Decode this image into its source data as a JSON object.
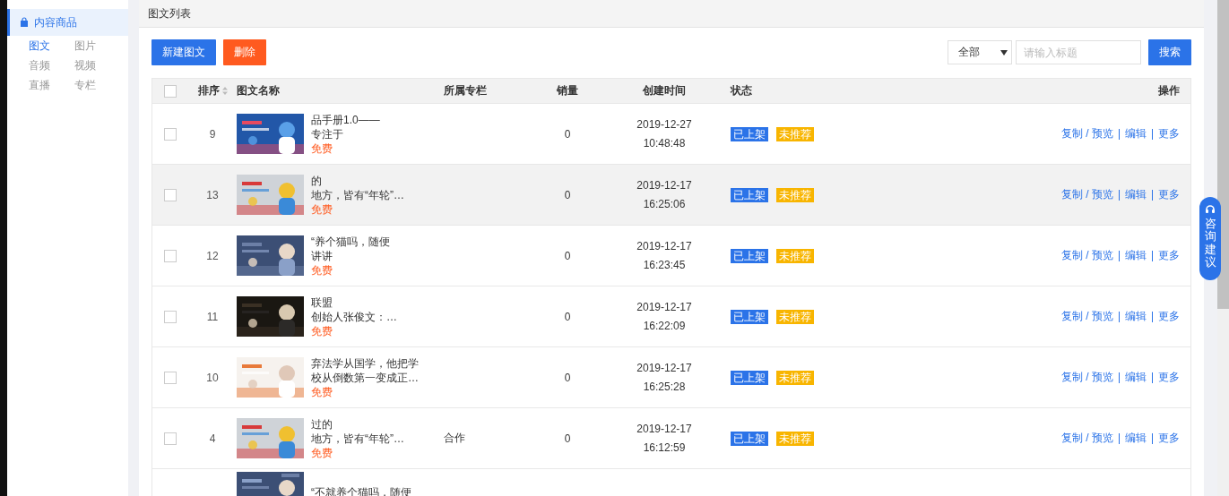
{
  "sidebar": {
    "group": {
      "label": "内容商品",
      "selected": true
    },
    "items": [
      {
        "label": "图文",
        "selected": true
      },
      {
        "label": "图片",
        "selected": false
      },
      {
        "label": "音频",
        "selected": false
      },
      {
        "label": "视频",
        "selected": false
      },
      {
        "label": "直播",
        "selected": false
      },
      {
        "label": "专栏",
        "selected": false
      }
    ]
  },
  "page_title": "图文列表",
  "toolbar": {
    "new_button": "新建图文",
    "delete_button": "删除",
    "filter": {
      "value": "全部"
    },
    "search": {
      "placeholder": "请输入标题"
    },
    "search_button": "搜索"
  },
  "table": {
    "columns": [
      "排序",
      "图文名称",
      "所属专栏",
      "销量",
      "创建时间",
      "状态",
      "操作"
    ],
    "rows": [
      {
        "order": "9",
        "title": [
          "品手册1.0——",
          "专注于"
        ],
        "price": "免费",
        "column": [],
        "sales": "0",
        "date": "2019-12-27",
        "time": "10:48:48",
        "status": "已上架",
        "recommend": "未推荐",
        "hovered": false,
        "actions": [
          "复制 / 预览",
          "编辑",
          "更多"
        ]
      },
      {
        "order": "13",
        "title": [
          "的",
          "地方，皆有“年轮”…"
        ],
        "price": "免费",
        "column": [],
        "sales": "0",
        "date": "2019-12-17",
        "time": "16:25:06",
        "status": "已上架",
        "recommend": "未推荐",
        "hovered": true,
        "actions": [
          "复制 / 预览",
          "编辑",
          "更多"
        ]
      },
      {
        "order": "12",
        "title": [
          "“养个猫吗，随便",
          "讲讲"
        ],
        "price": "免费",
        "column": [],
        "sales": "0",
        "date": "2019-12-17",
        "time": "16:23:45",
        "status": "已上架",
        "recommend": "未推荐",
        "hovered": false,
        "actions": [
          "复制 / 预览",
          "编辑",
          "更多"
        ]
      },
      {
        "order": "11",
        "title": [
          "联盟",
          "创始人张俊文：…"
        ],
        "price": "免费",
        "column": [],
        "sales": "0",
        "date": "2019-12-17",
        "time": "16:22:09",
        "status": "已上架",
        "recommend": "未推荐",
        "hovered": false,
        "actions": [
          "复制 / 预览",
          "编辑",
          "更多"
        ]
      },
      {
        "order": "10",
        "title": [
          "弃法学从国学，他把学",
          "校从倒数第一变成正…"
        ],
        "price": "免费",
        "column": [],
        "sales": "0",
        "date": "2019-12-17",
        "time": "16:25:28",
        "status": "已上架",
        "recommend": "未推荐",
        "hovered": false,
        "actions": [
          "复制 / 预览",
          "编辑",
          "更多"
        ]
      },
      {
        "order": "4",
        "title": [
          "过的",
          "地方，皆有“年轮”…"
        ],
        "price": "免费",
        "column": [
          "合作"
        ],
        "sales": "0",
        "date": "2019-12-17",
        "time": "16:12:59",
        "status": "已上架",
        "recommend": "未推荐",
        "hovered": false,
        "actions": [
          "复制 / 预览",
          "编辑",
          "更多"
        ]
      }
    ],
    "partial_row": {
      "title": "“不就养个猫吗，随便"
    },
    "all_checked": false
  },
  "float_button": "咨询建议"
}
